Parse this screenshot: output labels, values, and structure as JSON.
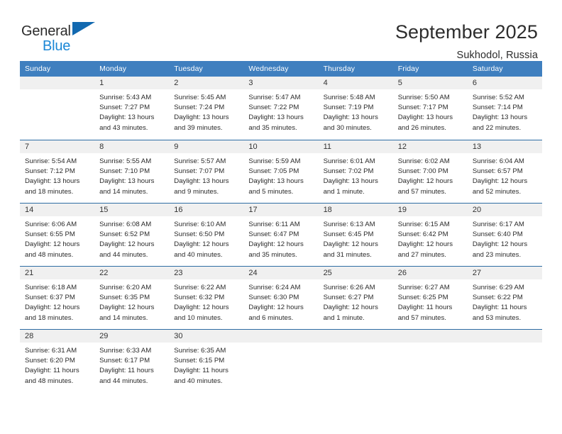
{
  "brand": {
    "name_part1": "General",
    "name_part2": "Blue",
    "accent_color": "#1269b0",
    "accent_color_light": "#1b87d6"
  },
  "header": {
    "title": "September 2025",
    "location": "Sukhodol, Russia"
  },
  "theme": {
    "header_row_bg": "#3f7fbf",
    "day_band_bg": "#f0f0f0",
    "row_divider": "#2e6da4"
  },
  "weekdays": [
    "Sunday",
    "Monday",
    "Tuesday",
    "Wednesday",
    "Thursday",
    "Friday",
    "Saturday"
  ],
  "weeks": [
    [
      {
        "day": "",
        "empty": true
      },
      {
        "day": "1",
        "sunrise": "Sunrise: 5:43 AM",
        "sunset": "Sunset: 7:27 PM",
        "daylight1": "Daylight: 13 hours",
        "daylight2": "and 43 minutes."
      },
      {
        "day": "2",
        "sunrise": "Sunrise: 5:45 AM",
        "sunset": "Sunset: 7:24 PM",
        "daylight1": "Daylight: 13 hours",
        "daylight2": "and 39 minutes."
      },
      {
        "day": "3",
        "sunrise": "Sunrise: 5:47 AM",
        "sunset": "Sunset: 7:22 PM",
        "daylight1": "Daylight: 13 hours",
        "daylight2": "and 35 minutes."
      },
      {
        "day": "4",
        "sunrise": "Sunrise: 5:48 AM",
        "sunset": "Sunset: 7:19 PM",
        "daylight1": "Daylight: 13 hours",
        "daylight2": "and 30 minutes."
      },
      {
        "day": "5",
        "sunrise": "Sunrise: 5:50 AM",
        "sunset": "Sunset: 7:17 PM",
        "daylight1": "Daylight: 13 hours",
        "daylight2": "and 26 minutes."
      },
      {
        "day": "6",
        "sunrise": "Sunrise: 5:52 AM",
        "sunset": "Sunset: 7:14 PM",
        "daylight1": "Daylight: 13 hours",
        "daylight2": "and 22 minutes."
      }
    ],
    [
      {
        "day": "7",
        "sunrise": "Sunrise: 5:54 AM",
        "sunset": "Sunset: 7:12 PM",
        "daylight1": "Daylight: 13 hours",
        "daylight2": "and 18 minutes."
      },
      {
        "day": "8",
        "sunrise": "Sunrise: 5:55 AM",
        "sunset": "Sunset: 7:10 PM",
        "daylight1": "Daylight: 13 hours",
        "daylight2": "and 14 minutes."
      },
      {
        "day": "9",
        "sunrise": "Sunrise: 5:57 AM",
        "sunset": "Sunset: 7:07 PM",
        "daylight1": "Daylight: 13 hours",
        "daylight2": "and 9 minutes."
      },
      {
        "day": "10",
        "sunrise": "Sunrise: 5:59 AM",
        "sunset": "Sunset: 7:05 PM",
        "daylight1": "Daylight: 13 hours",
        "daylight2": "and 5 minutes."
      },
      {
        "day": "11",
        "sunrise": "Sunrise: 6:01 AM",
        "sunset": "Sunset: 7:02 PM",
        "daylight1": "Daylight: 13 hours",
        "daylight2": "and 1 minute."
      },
      {
        "day": "12",
        "sunrise": "Sunrise: 6:02 AM",
        "sunset": "Sunset: 7:00 PM",
        "daylight1": "Daylight: 12 hours",
        "daylight2": "and 57 minutes."
      },
      {
        "day": "13",
        "sunrise": "Sunrise: 6:04 AM",
        "sunset": "Sunset: 6:57 PM",
        "daylight1": "Daylight: 12 hours",
        "daylight2": "and 52 minutes."
      }
    ],
    [
      {
        "day": "14",
        "sunrise": "Sunrise: 6:06 AM",
        "sunset": "Sunset: 6:55 PM",
        "daylight1": "Daylight: 12 hours",
        "daylight2": "and 48 minutes."
      },
      {
        "day": "15",
        "sunrise": "Sunrise: 6:08 AM",
        "sunset": "Sunset: 6:52 PM",
        "daylight1": "Daylight: 12 hours",
        "daylight2": "and 44 minutes."
      },
      {
        "day": "16",
        "sunrise": "Sunrise: 6:10 AM",
        "sunset": "Sunset: 6:50 PM",
        "daylight1": "Daylight: 12 hours",
        "daylight2": "and 40 minutes."
      },
      {
        "day": "17",
        "sunrise": "Sunrise: 6:11 AM",
        "sunset": "Sunset: 6:47 PM",
        "daylight1": "Daylight: 12 hours",
        "daylight2": "and 35 minutes."
      },
      {
        "day": "18",
        "sunrise": "Sunrise: 6:13 AM",
        "sunset": "Sunset: 6:45 PM",
        "daylight1": "Daylight: 12 hours",
        "daylight2": "and 31 minutes."
      },
      {
        "day": "19",
        "sunrise": "Sunrise: 6:15 AM",
        "sunset": "Sunset: 6:42 PM",
        "daylight1": "Daylight: 12 hours",
        "daylight2": "and 27 minutes."
      },
      {
        "day": "20",
        "sunrise": "Sunrise: 6:17 AM",
        "sunset": "Sunset: 6:40 PM",
        "daylight1": "Daylight: 12 hours",
        "daylight2": "and 23 minutes."
      }
    ],
    [
      {
        "day": "21",
        "sunrise": "Sunrise: 6:18 AM",
        "sunset": "Sunset: 6:37 PM",
        "daylight1": "Daylight: 12 hours",
        "daylight2": "and 18 minutes."
      },
      {
        "day": "22",
        "sunrise": "Sunrise: 6:20 AM",
        "sunset": "Sunset: 6:35 PM",
        "daylight1": "Daylight: 12 hours",
        "daylight2": "and 14 minutes."
      },
      {
        "day": "23",
        "sunrise": "Sunrise: 6:22 AM",
        "sunset": "Sunset: 6:32 PM",
        "daylight1": "Daylight: 12 hours",
        "daylight2": "and 10 minutes."
      },
      {
        "day": "24",
        "sunrise": "Sunrise: 6:24 AM",
        "sunset": "Sunset: 6:30 PM",
        "daylight1": "Daylight: 12 hours",
        "daylight2": "and 6 minutes."
      },
      {
        "day": "25",
        "sunrise": "Sunrise: 6:26 AM",
        "sunset": "Sunset: 6:27 PM",
        "daylight1": "Daylight: 12 hours",
        "daylight2": "and 1 minute."
      },
      {
        "day": "26",
        "sunrise": "Sunrise: 6:27 AM",
        "sunset": "Sunset: 6:25 PM",
        "daylight1": "Daylight: 11 hours",
        "daylight2": "and 57 minutes."
      },
      {
        "day": "27",
        "sunrise": "Sunrise: 6:29 AM",
        "sunset": "Sunset: 6:22 PM",
        "daylight1": "Daylight: 11 hours",
        "daylight2": "and 53 minutes."
      }
    ],
    [
      {
        "day": "28",
        "sunrise": "Sunrise: 6:31 AM",
        "sunset": "Sunset: 6:20 PM",
        "daylight1": "Daylight: 11 hours",
        "daylight2": "and 48 minutes."
      },
      {
        "day": "29",
        "sunrise": "Sunrise: 6:33 AM",
        "sunset": "Sunset: 6:17 PM",
        "daylight1": "Daylight: 11 hours",
        "daylight2": "and 44 minutes."
      },
      {
        "day": "30",
        "sunrise": "Sunrise: 6:35 AM",
        "sunset": "Sunset: 6:15 PM",
        "daylight1": "Daylight: 11 hours",
        "daylight2": "and 40 minutes."
      },
      {
        "day": "",
        "empty": true
      },
      {
        "day": "",
        "empty": true
      },
      {
        "day": "",
        "empty": true
      },
      {
        "day": "",
        "empty": true
      }
    ]
  ]
}
